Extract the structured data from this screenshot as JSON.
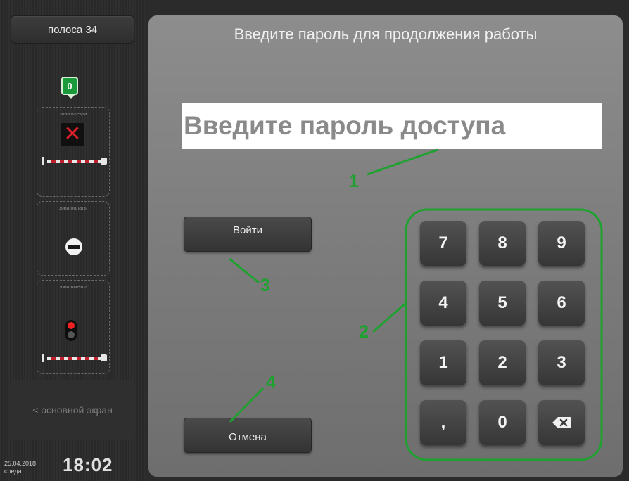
{
  "sidebar": {
    "lane_label": "полоса 34",
    "counter": "0",
    "zones": [
      "зона въезда",
      "зона оплаты",
      "зона выезда"
    ],
    "main_screen_label": "< основной экран",
    "date": "25.04.2018",
    "weekday": "среда",
    "time": "18:02"
  },
  "main": {
    "title": "Введите пароль для продолжения работы",
    "password_placeholder": "Введите пароль доступа",
    "login_label": "Войти",
    "cancel_label": "Отмена",
    "keys": [
      "7",
      "8",
      "9",
      "4",
      "5",
      "6",
      "1",
      "2",
      "3",
      ",",
      "0"
    ]
  },
  "annotations": {
    "labels": [
      "1",
      "2",
      "3",
      "4"
    ],
    "color": "#1fa12f"
  },
  "colors": {
    "panel": "#808080",
    "key": "#414141",
    "counter_badge": "#1a9a3a",
    "signal_red": "#e22222"
  },
  "icons": {
    "backspace": "backspace-icon",
    "x_mark": "red-x-icon",
    "no_entry": "no-entry-icon",
    "traffic_light": "traffic-light-icon",
    "barrier": "barrier-icon"
  }
}
